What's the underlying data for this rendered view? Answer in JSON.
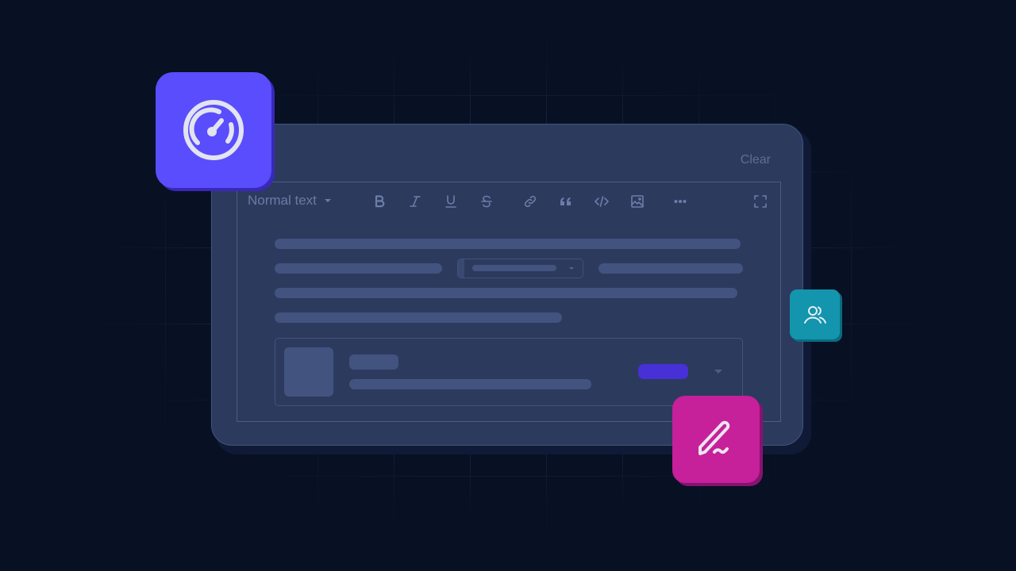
{
  "card": {
    "clear_label": "Clear"
  },
  "toolbar": {
    "text_style": "Normal text",
    "buttons": [
      {
        "name": "bold",
        "icon": "bold-icon"
      },
      {
        "name": "italic",
        "icon": "italic-icon"
      },
      {
        "name": "underline",
        "icon": "underline-icon"
      },
      {
        "name": "strikethrough",
        "icon": "strikethrough-icon"
      },
      {
        "name": "link",
        "icon": "link-icon"
      },
      {
        "name": "quote",
        "icon": "quote-icon"
      },
      {
        "name": "code",
        "icon": "code-icon"
      },
      {
        "name": "image",
        "icon": "image-icon"
      },
      {
        "name": "more",
        "icon": "more-icon"
      },
      {
        "name": "fullscreen",
        "icon": "fullscreen-icon"
      }
    ]
  },
  "floating_icons": [
    {
      "name": "gauge",
      "icon": "gauge-icon",
      "color": "#5a4dfd"
    },
    {
      "name": "users",
      "icon": "users-icon",
      "color": "#1295ad"
    },
    {
      "name": "signature",
      "icon": "signature-icon",
      "color": "#c6209a"
    }
  ],
  "colors": {
    "background": "#081024",
    "card": "#2c3a5e",
    "placeholder": "#435380",
    "accent_badge": "#4630d6",
    "muted_text": "#6a7ba3"
  }
}
